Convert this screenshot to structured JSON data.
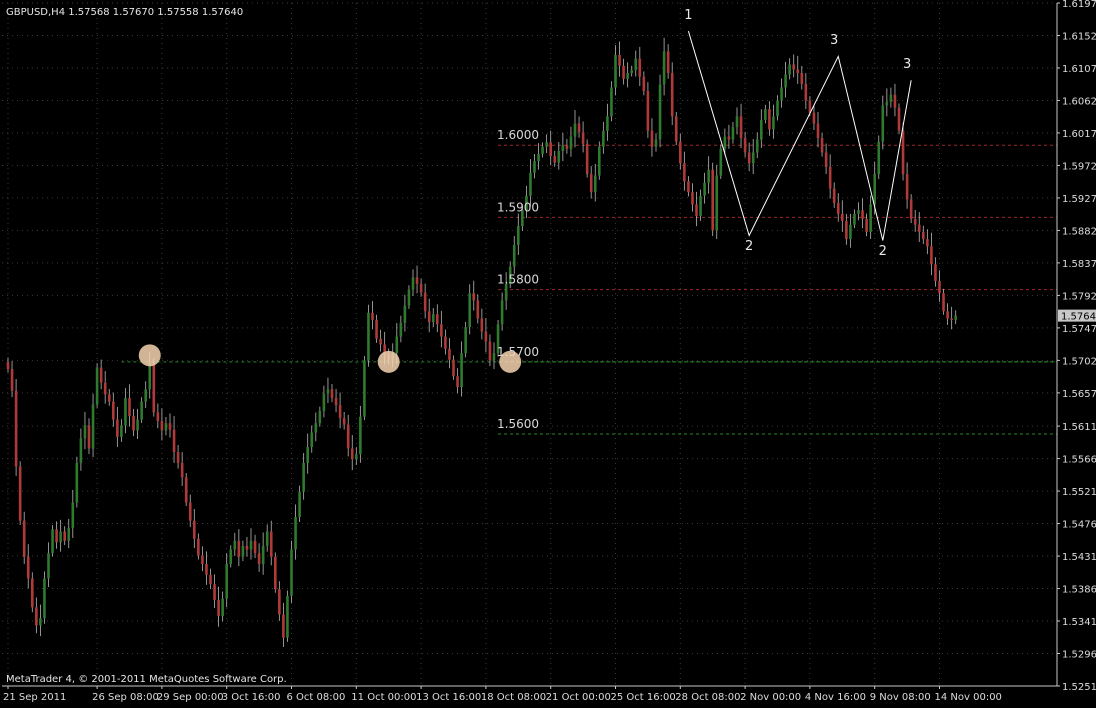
{
  "chart_data": {
    "type": "candlestick",
    "symbol_header": "GBPUSD,H4  1.57568 1.57670 1.57558 1.57640",
    "copyright": "MetaTrader 4, © 2001-2011 MetaQuotes Software Corp.",
    "colors": {
      "background": "#000000",
      "axis": "#c8c8c8",
      "grid": "#3a3a3a",
      "bull": "#2f7a2f",
      "bear": "#b03a3a",
      "wick": "#b8b8b8",
      "resistance": "#9c2a2a",
      "support": "#2a8a2a",
      "pattern": "#ffffff",
      "circle_marker": "#f6d2b0",
      "last_price_bg": "#c8c8c8"
    },
    "ylim": [
      1.5251,
      1.6197
    ],
    "y_ticks": [
      "1.61970",
      "1.61520",
      "1.61070",
      "1.60620",
      "1.60170",
      "1.59720",
      "1.59270",
      "1.58820",
      "1.58370",
      "1.57920",
      "1.57470",
      "1.57020",
      "1.56570",
      "1.56110",
      "1.55660",
      "1.55210",
      "1.54760",
      "1.54310",
      "1.53860",
      "1.53410",
      "1.52960",
      "1.52510"
    ],
    "x_ticks": [
      {
        "label": "21 Sep 2011",
        "bar": 0
      },
      {
        "label": "26 Sep 08:00",
        "bar": 22
      },
      {
        "label": "29 Sep 00:00",
        "bar": 38
      },
      {
        "label": "3 Oct 16:00",
        "bar": 54
      },
      {
        "label": "6 Oct 08:00",
        "bar": 70
      },
      {
        "label": "11 Oct 00:00",
        "bar": 86
      },
      {
        "label": "13 Oct 16:00",
        "bar": 102
      },
      {
        "label": "18 Oct 08:00",
        "bar": 118
      },
      {
        "label": "21 Oct 00:00",
        "bar": 134
      },
      {
        "label": "25 Oct 16:00",
        "bar": 150
      },
      {
        "label": "28 Oct 08:00",
        "bar": 166
      },
      {
        "label": "2 Nov 00:00",
        "bar": 182
      },
      {
        "label": "4 Nov 16:00",
        "bar": 198
      },
      {
        "label": "9 Nov 08:00",
        "bar": 214
      },
      {
        "label": "14 Nov 00:00",
        "bar": 230
      }
    ],
    "last_price": "1.57640",
    "levels": [
      {
        "label": "1.6000",
        "price": 1.6,
        "start_bar": 121,
        "kind": "resistance"
      },
      {
        "label": "1.5900",
        "price": 1.59,
        "start_bar": 121,
        "kind": "resistance"
      },
      {
        "label": "1.5800",
        "price": 1.58,
        "start_bar": 121,
        "kind": "resistance"
      },
      {
        "label": "1.5700",
        "price": 1.57,
        "start_bar": 121,
        "kind": "support"
      },
      {
        "label": "1.5600",
        "price": 1.56,
        "start_bar": 121,
        "kind": "support"
      }
    ],
    "support_line": {
      "price": 1.57,
      "start_bar": 28
    },
    "markers": [
      {
        "bar": 35,
        "price": 1.5709
      },
      {
        "bar": 94,
        "price": 1.57
      },
      {
        "bar": 124,
        "price": 1.57
      }
    ],
    "pattern_lines": [
      [
        {
          "bar": 168,
          "price": 1.6158
        },
        {
          "bar": 183,
          "price": 1.5875
        },
        {
          "bar": 205,
          "price": 1.6123
        },
        {
          "bar": 216,
          "price": 1.5868
        },
        {
          "bar": 223,
          "price": 1.609
        }
      ]
    ],
    "pattern_labels": [
      {
        "text": "1",
        "bar": 168,
        "price": 1.6175
      },
      {
        "text": "2",
        "bar": 183,
        "price": 1.5855
      },
      {
        "text": "3",
        "bar": 204,
        "price": 1.614
      },
      {
        "text": "2",
        "bar": 216,
        "price": 1.5848
      },
      {
        "text": "3",
        "bar": 222,
        "price": 1.6107
      }
    ],
    "close_series": [
      1.569,
      1.566,
      1.5555,
      1.548,
      1.543,
      1.54,
      1.536,
      1.5335,
      1.5345,
      1.54,
      1.5435,
      1.5468,
      1.545,
      1.5465,
      1.5452,
      1.547,
      1.5505,
      1.556,
      1.5594,
      1.5612,
      1.558,
      1.5641,
      1.5692,
      1.5671,
      1.5655,
      1.5645,
      1.562,
      1.5596,
      1.5612,
      1.565,
      1.5625,
      1.5605,
      1.562,
      1.5645,
      1.5662,
      1.5698,
      1.563,
      1.5618,
      1.5605,
      1.5615,
      1.5606,
      1.5575,
      1.556,
      1.554,
      1.5505,
      1.548,
      1.5455,
      1.5432,
      1.542,
      1.5405,
      1.5392,
      1.537,
      1.5348,
      1.5372,
      1.542,
      1.544,
      1.5452,
      1.543,
      1.5445,
      1.544,
      1.5452,
      1.5435,
      1.542,
      1.5445,
      1.5465,
      1.543,
      1.5385,
      1.535,
      1.5318,
      1.5376,
      1.544,
      1.5485,
      1.552,
      1.556,
      1.5582,
      1.5602,
      1.5615,
      1.5632,
      1.5656,
      1.5662,
      1.565,
      1.564,
      1.5622,
      1.5613,
      1.558,
      1.5565,
      1.5572,
      1.5624,
      1.5702,
      1.5768,
      1.5758,
      1.5732,
      1.5724,
      1.571,
      1.5703,
      1.5712,
      1.5735,
      1.5754,
      1.5778,
      1.58,
      1.5817,
      1.5808,
      1.5796,
      1.577,
      1.5755,
      1.5766,
      1.5752,
      1.5735,
      1.5718,
      1.5703,
      1.568,
      1.5665,
      1.5712,
      1.5748,
      1.5795,
      1.5785,
      1.576,
      1.5742,
      1.5728,
      1.5702,
      1.5712,
      1.5752,
      1.5785,
      1.5808,
      1.5832,
      1.5862,
      1.5888,
      1.591,
      1.593,
      1.5962,
      1.5978,
      1.5988,
      1.5998,
      1.6004,
      1.5985,
      1.5976,
      1.5992,
      1.6,
      1.5995,
      1.6012,
      1.603,
      1.6018,
      1.6002,
      1.596,
      1.5935,
      1.5958,
      1.5998,
      1.602,
      1.604,
      1.608,
      1.6125,
      1.611,
      1.6092,
      1.61,
      1.6104,
      1.612,
      1.6095,
      1.6075,
      1.602,
      1.5998,
      1.6008,
      1.6084,
      1.613,
      1.61,
      1.604,
      1.6005,
      1.5975,
      1.595,
      1.5935,
      1.5918,
      1.5902,
      1.593,
      1.5948,
      1.5966,
      1.5882,
      1.5958,
      1.5995,
      1.6012,
      1.6008,
      1.6025,
      1.604,
      1.601,
      1.599,
      1.5975,
      1.599,
      1.6008,
      1.6035,
      1.605,
      1.6022,
      1.604,
      1.6062,
      1.608,
      1.6098,
      1.6112,
      1.6105,
      1.61,
      1.6085,
      1.6062,
      1.6045,
      1.603,
      1.601,
      1.599,
      1.597,
      1.594,
      1.592,
      1.5905,
      1.5895,
      1.587,
      1.589,
      1.5905,
      1.591,
      1.5898,
      1.588,
      1.5918,
      1.596,
      1.6005,
      1.6055,
      1.606,
      1.607,
      1.6052,
      1.602,
      1.596,
      1.5925,
      1.5898,
      1.589,
      1.588,
      1.587,
      1.586,
      1.5835,
      1.5812,
      1.5795,
      1.577,
      1.576,
      1.5758,
      1.5764
    ]
  }
}
